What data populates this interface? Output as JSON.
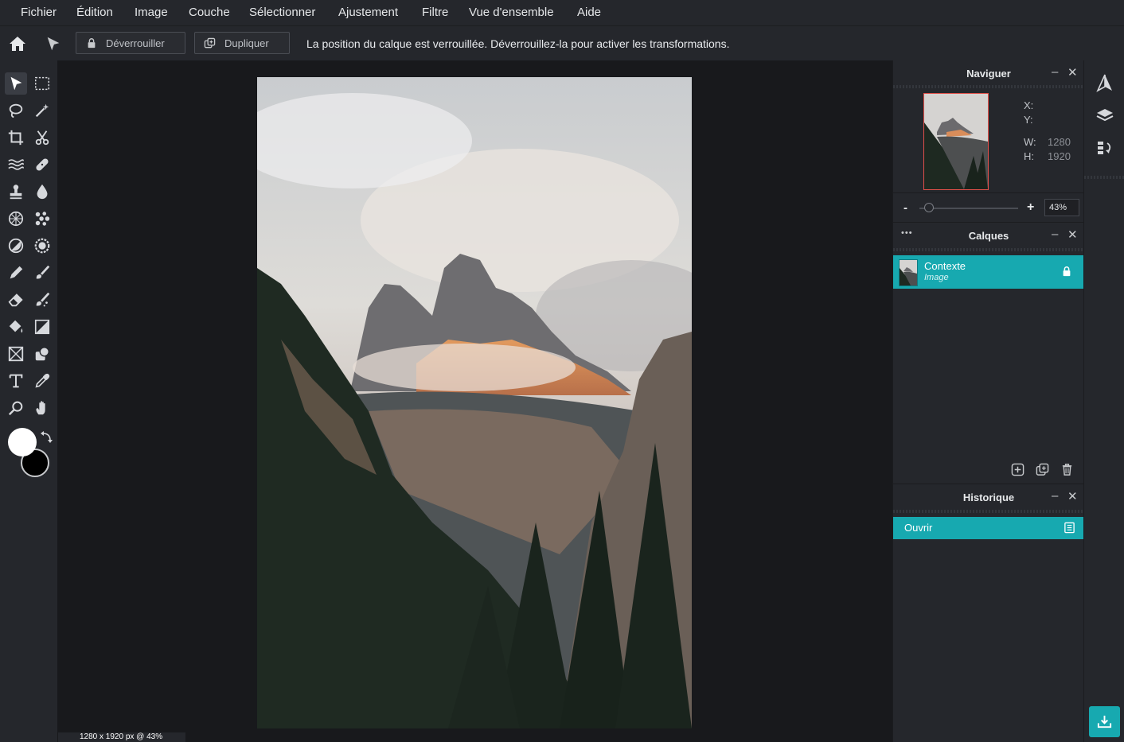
{
  "menu": {
    "items": [
      "Fichier",
      "Édition",
      "Image",
      "Couche",
      "Sélectionner",
      "Ajustement",
      "Filtre",
      "Vue d'ensemble",
      "Aide"
    ]
  },
  "options": {
    "unlock_label": "Déverrouiller",
    "duplicate_label": "Dupliquer",
    "lock_message": "La position du calque est verrouillée. Déverrouillez-la pour activer les transformations."
  },
  "navigator": {
    "title": "Naviguer",
    "x_label": "X:",
    "y_label": "Y:",
    "w_label": "W:",
    "w_value": "1280",
    "h_label": "H:",
    "h_value": "1920",
    "zoom_minus": "-",
    "zoom_plus": "+",
    "zoom_value": "43%",
    "zoom_level": 0.1
  },
  "layers": {
    "title": "Calques",
    "menu_dots": "•••",
    "items": [
      {
        "name": "Contexte",
        "type": "Image",
        "locked": true
      }
    ]
  },
  "history": {
    "title": "Historique",
    "items": [
      {
        "label": "Ouvrir"
      }
    ]
  },
  "status": {
    "text": "1280 x 1920 px @ 43%"
  },
  "colors": {
    "accent": "#17a9b0",
    "foreground": "#ffffff",
    "background": "#000000"
  }
}
